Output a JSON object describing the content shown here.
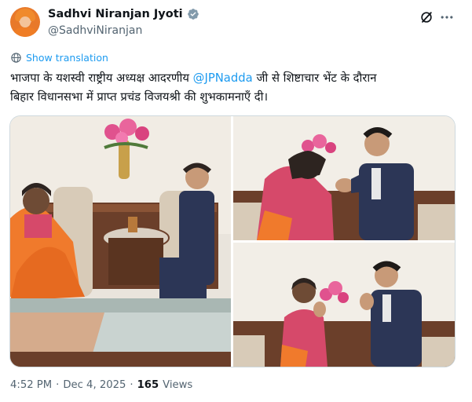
{
  "author": {
    "display_name": "Sadhvi Niranjan Jyoti",
    "handle": "@SadhviNiranjan",
    "verified_icon": "verified-badge-icon"
  },
  "header_actions": {
    "grok_icon": "grok-icon",
    "more_icon": "more-horizontal-icon"
  },
  "translate": {
    "icon": "globe-icon",
    "label": "Show translation"
  },
  "tweet": {
    "text_before_mention": "भाजपा के यशस्वी राष्ट्रीय अध्यक्ष आदरणीय ",
    "mention": "@JPNadda",
    "text_after_mention_line1": " जी से शिष्टाचार भेंट के दौरान",
    "text_line2": "बिहार विधानसभा में प्राप्त प्रचंड विजयश्री की शुभकामनाएँ दी।"
  },
  "media": {
    "photo_count": 3
  },
  "footer": {
    "time": "4:52 PM",
    "separator": "·",
    "date": "Dec 4, 2025",
    "separator2": "·",
    "views_count": "165",
    "views_label": "Views"
  },
  "colors": {
    "accent": "#1d9bf0",
    "text": "#0f1419",
    "secondary": "#536471",
    "border": "#cfd9de"
  }
}
